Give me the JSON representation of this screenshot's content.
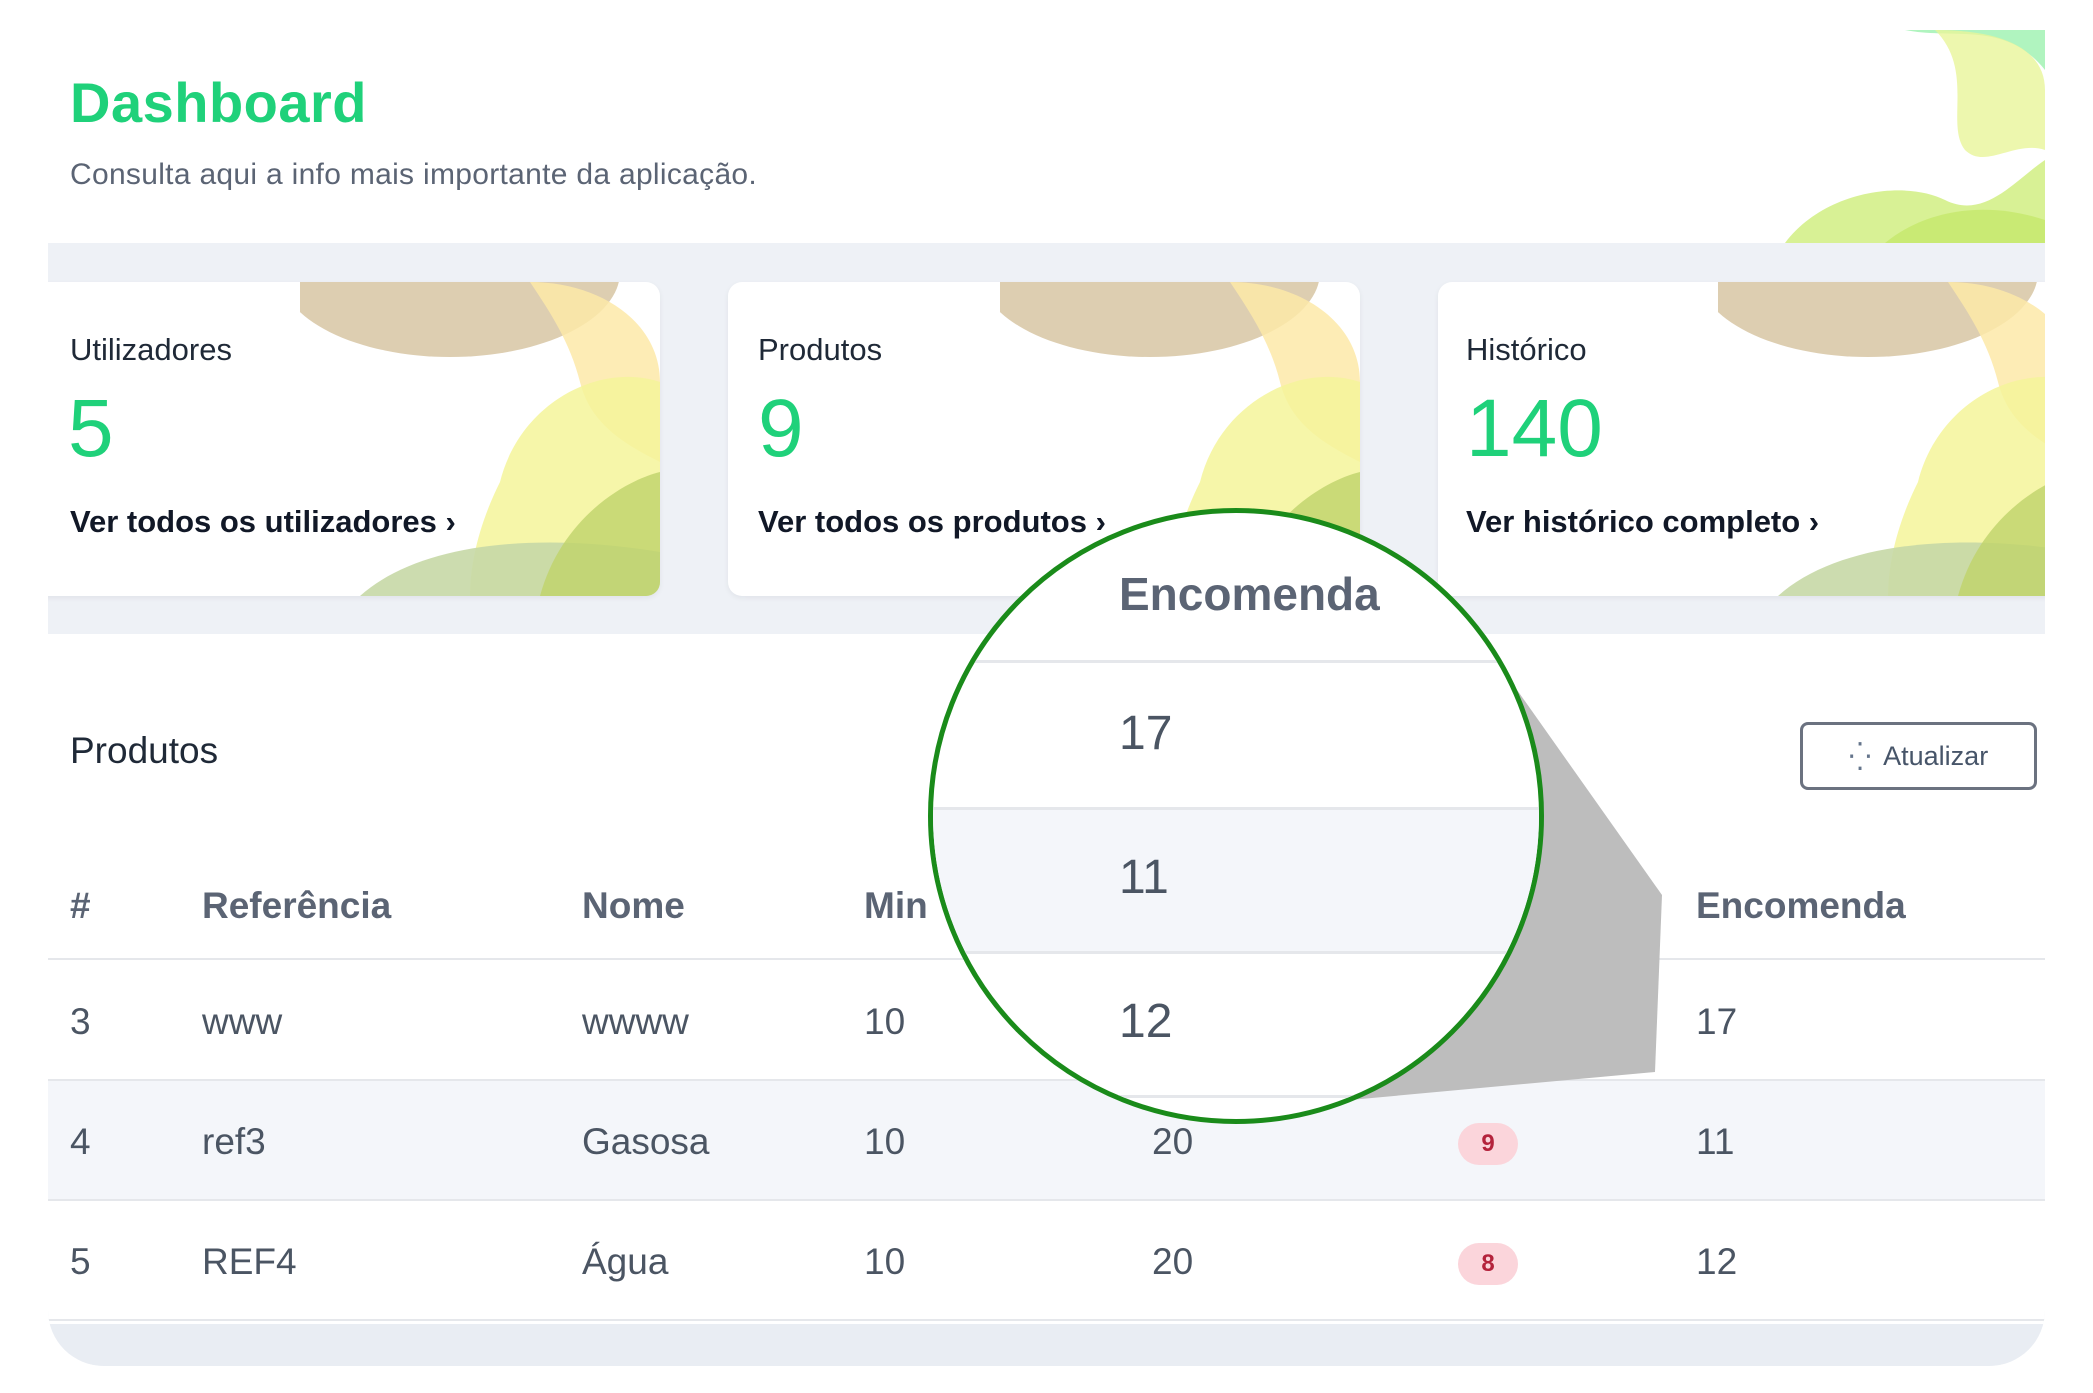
{
  "header": {
    "title": "Dashboard",
    "subtitle": "Consulta aqui a info mais importante da aplicação."
  },
  "cards": [
    {
      "label": "Utilizadores",
      "value": "5",
      "link": "Ver todos os utilizadores ›"
    },
    {
      "label": "Produtos",
      "value": "9",
      "link": "Ver todos os produtos ›"
    },
    {
      "label": "Histórico",
      "value": "140",
      "link": "Ver histórico completo ›"
    }
  ],
  "products": {
    "title": "Produtos",
    "refresh_label": "Atualizar",
    "refresh_icon": "spinner-icon",
    "columns": [
      "#",
      "Referência",
      "Nome",
      "Min",
      "",
      "",
      "Encomenda"
    ],
    "rows": [
      {
        "id": "3",
        "ref": "www",
        "name": "wwww",
        "min": "10",
        "c4": "",
        "badge": "",
        "order": "17"
      },
      {
        "id": "4",
        "ref": "ref3",
        "name": "Gasosa",
        "min": "10",
        "c4": "20",
        "badge": "9",
        "order": "11"
      },
      {
        "id": "5",
        "ref": "REF4",
        "name": "Água",
        "min": "10",
        "c4": "20",
        "badge": "8",
        "order": "12"
      }
    ]
  },
  "magnifier": {
    "header": "Encomenda",
    "values": [
      "17",
      "11",
      "12"
    ]
  },
  "colors": {
    "accent": "#1fd17a",
    "badge_bg": "#fbd5db",
    "badge_text": "#b4233c",
    "magnifier_border": "#1a8b1a"
  }
}
